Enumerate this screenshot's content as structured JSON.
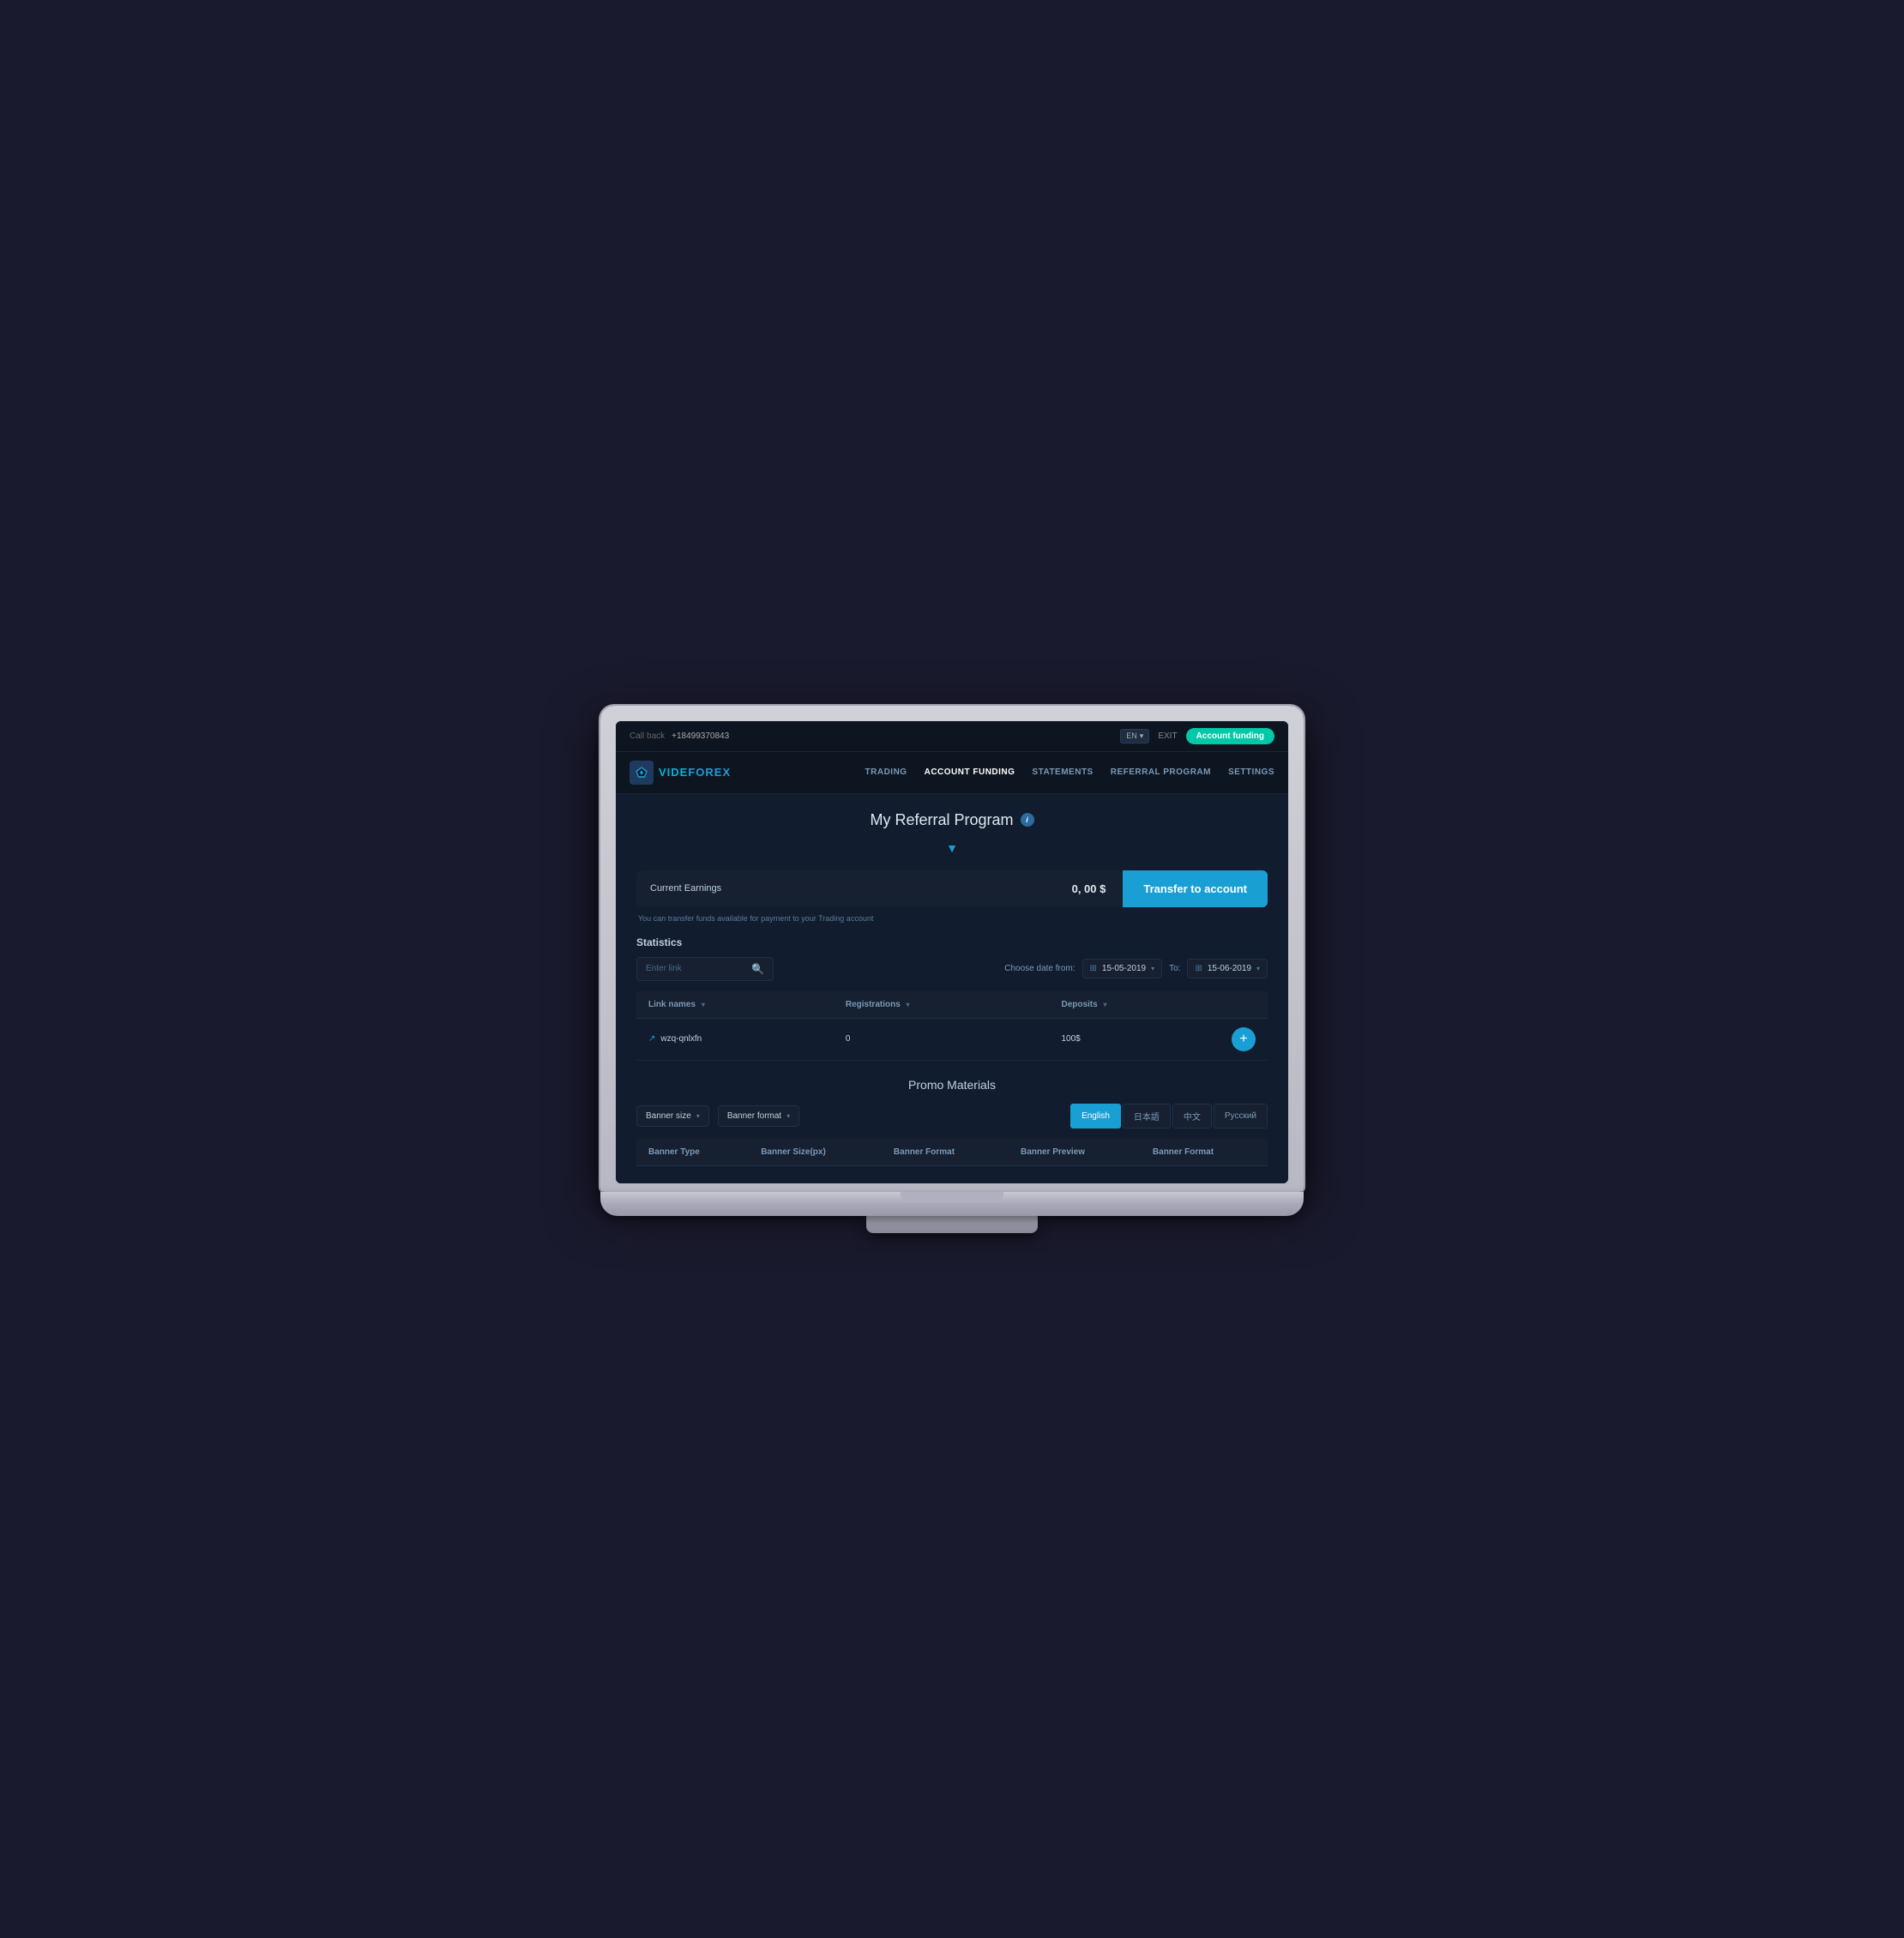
{
  "topbar": {
    "callback_label": "Call back",
    "phone": "+18499370843",
    "lang": "EN",
    "exit_label": "EXIT",
    "account_funding_label": "Account funding"
  },
  "nav": {
    "logo_text_part1": "VIDE",
    "logo_text_part2": "FOREX",
    "links": [
      {
        "id": "trading",
        "label": "TRADING",
        "active": false
      },
      {
        "id": "account-funding",
        "label": "ACCOUNT FUNDING",
        "active": true
      },
      {
        "id": "statements",
        "label": "STATEMENTS",
        "active": false
      },
      {
        "id": "referral-program",
        "label": "REFERRAL PROGRAM",
        "active": false
      },
      {
        "id": "settings",
        "label": "SETTINGS",
        "active": false
      }
    ]
  },
  "page": {
    "title": "My Referral Program",
    "info_icon": "i",
    "earnings": {
      "label": "Current Earnings",
      "amount": "0, 00 $",
      "transfer_btn_label": "Transfer to account",
      "note": "You can transfer funds available for payment to your Trading account"
    },
    "statistics": {
      "section_label": "Statistics",
      "search_placeholder": "Enter link",
      "date_from_label": "Choose date from:",
      "date_from": "15-05-2019",
      "date_to_label": "To:",
      "date_to": "15-06-2019",
      "table": {
        "columns": [
          {
            "id": "link-names",
            "label": "Link names"
          },
          {
            "id": "registrations",
            "label": "Registrations"
          },
          {
            "id": "deposits",
            "label": "Deposits"
          }
        ],
        "rows": [
          {
            "link": "wzq-qnlxfn",
            "registrations": "0",
            "deposits": "100$"
          }
        ]
      }
    },
    "promo": {
      "title": "Promo Materials",
      "banner_size_label": "Banner size",
      "banner_format_label": "Banner format",
      "lang_tabs": [
        {
          "id": "english",
          "label": "English",
          "active": true
        },
        {
          "id": "japanese",
          "label": "日本語",
          "active": false
        },
        {
          "id": "chinese",
          "label": "中文",
          "active": false
        },
        {
          "id": "russian",
          "label": "Русский",
          "active": false
        }
      ],
      "banner_table_columns": [
        {
          "id": "banner-type",
          "label": "Banner Type"
        },
        {
          "id": "banner-size",
          "label": "Banner Size(px)"
        },
        {
          "id": "banner-format",
          "label": "Banner Format"
        },
        {
          "id": "banner-preview",
          "label": "Banner Preview"
        },
        {
          "id": "banner-format2",
          "label": "Banner Format"
        }
      ]
    }
  },
  "colors": {
    "accent": "#1a9fd4",
    "success": "#00c9a7",
    "bg_dark": "#0d1520",
    "bg_main": "#111d2e",
    "bg_card": "#162030"
  }
}
